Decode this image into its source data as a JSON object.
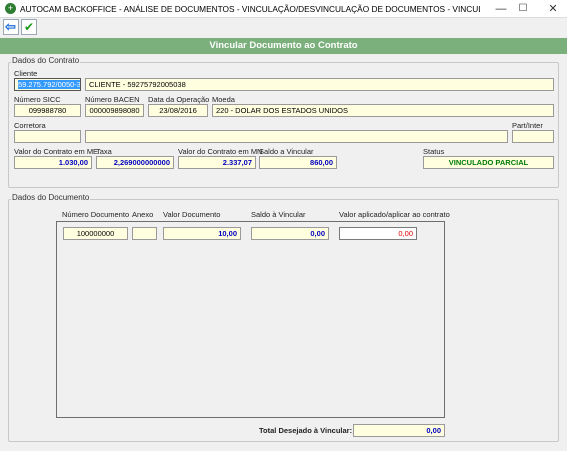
{
  "window": {
    "title": "AUTOCAM BACKOFFICE - ANÁLISE DE DOCUMENTOS - VINCULAÇÃO/DESVINCULAÇÃO DE DOCUMENTOS - VINCULAR DOCUMENTO A...",
    "minimize": "—",
    "maximize": "☐",
    "close": "✕"
  },
  "toolbar": {
    "back_icon": "⇦",
    "confirm_icon": "✔"
  },
  "header": {
    "title": "Vincular Documento ao Contrato"
  },
  "contrato": {
    "group_title": "Dados do Contrato",
    "cliente_label": "Cliente",
    "cliente_cnpj": "59.275.792/0050-38",
    "cliente_nome": "CLIENTE - 59275792005038",
    "sicc_label": "Número SICC",
    "sicc_value": "099988780",
    "bacen_label": "Número BACEN",
    "bacen_value": "000009898080",
    "data_label": "Data da Operação",
    "data_value": "23/08/2016",
    "moeda_label": "Moeda",
    "moeda_value": "220 - DOLAR DOS ESTADOS UNIDOS",
    "corretora_label": "Corretora",
    "corretora_code": "",
    "corretora_name": "",
    "partinter_label": "Part/Inter",
    "partinter_value": "",
    "valor_me_label": "Valor do Contrato em ME",
    "valor_me_value": "1.030,00",
    "taxa_label": "Taxa",
    "taxa_value": "2,269000000000",
    "valor_mn_label": "Valor do Contrato em MN",
    "valor_mn_value": "2.337,07",
    "saldo_label": "Saldo a Vincular",
    "saldo_value": "860,00",
    "status_label": "Status",
    "status_value": "VINCULADO PARCIAL"
  },
  "documento": {
    "group_title": "Dados do Documento",
    "numero_label": "Número Documento",
    "numero_value": "100000000",
    "anexo_label": "Anexo",
    "anexo_value": "",
    "valor_label": "Valor Documento",
    "valor_value": "10,00",
    "saldo_label": "Saldo à Vincular",
    "saldo_value": "0,00",
    "aplicado_label": "Valor aplicado/aplicar ao contrato",
    "aplicado_value": "0,00"
  },
  "footer": {
    "total_label": "Total Desejado à Vincular:",
    "total_value": "0,00"
  }
}
